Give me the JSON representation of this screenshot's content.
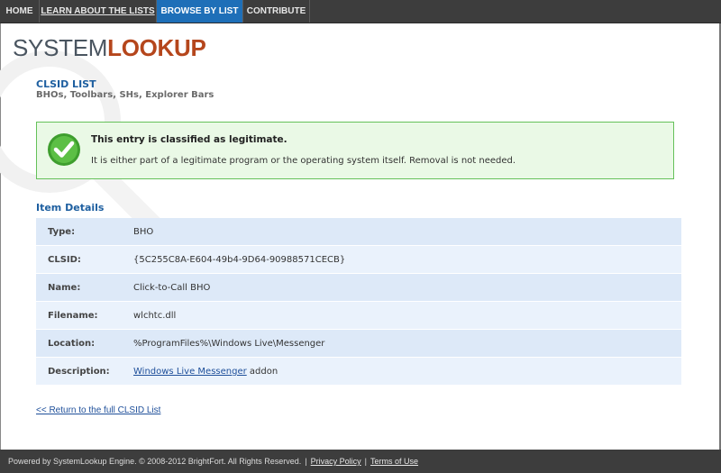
{
  "nav": {
    "items": [
      {
        "label": "HOME"
      },
      {
        "label": "LEARN ABOUT THE LISTS"
      },
      {
        "label": "BROWSE BY LIST"
      },
      {
        "label": "CONTRIBUTE"
      }
    ]
  },
  "logo": {
    "part1": "SYSTEM",
    "part2": "LOOKUP"
  },
  "list": {
    "title": "CLSID LIST",
    "subtitle": "BHOs, Toolbars, SHs, Explorer Bars"
  },
  "status": {
    "heading": "This entry is classified as legitimate.",
    "body": "It is either part of a legitimate program or the operating system itself. Removal is not needed.",
    "color": "#65c15a"
  },
  "details": {
    "title": "Item Details",
    "rows": [
      {
        "key": "Type:",
        "value": "BHO"
      },
      {
        "key": "CLSID:",
        "value": "{5C255C8A-E604-49b4-9D64-90988571CECB}"
      },
      {
        "key": "Name:",
        "value": "Click-to-Call BHO"
      },
      {
        "key": "Filename:",
        "value": "wlchtc.dll"
      },
      {
        "key": "Location:",
        "value": "%ProgramFiles%\\Windows Live\\Messenger"
      },
      {
        "key": "Description:",
        "link": "Windows Live Messenger",
        "suffix": " addon"
      }
    ]
  },
  "return_link": "<< Return to the full CLSID List",
  "footer": {
    "text": "Powered by SystemLookup Engine. © 2008-2012 BrightFort. All Rights Reserved.",
    "sep1": "|",
    "privacy": "Privacy Policy",
    "sep2": "|",
    "terms": "Terms of Use"
  }
}
